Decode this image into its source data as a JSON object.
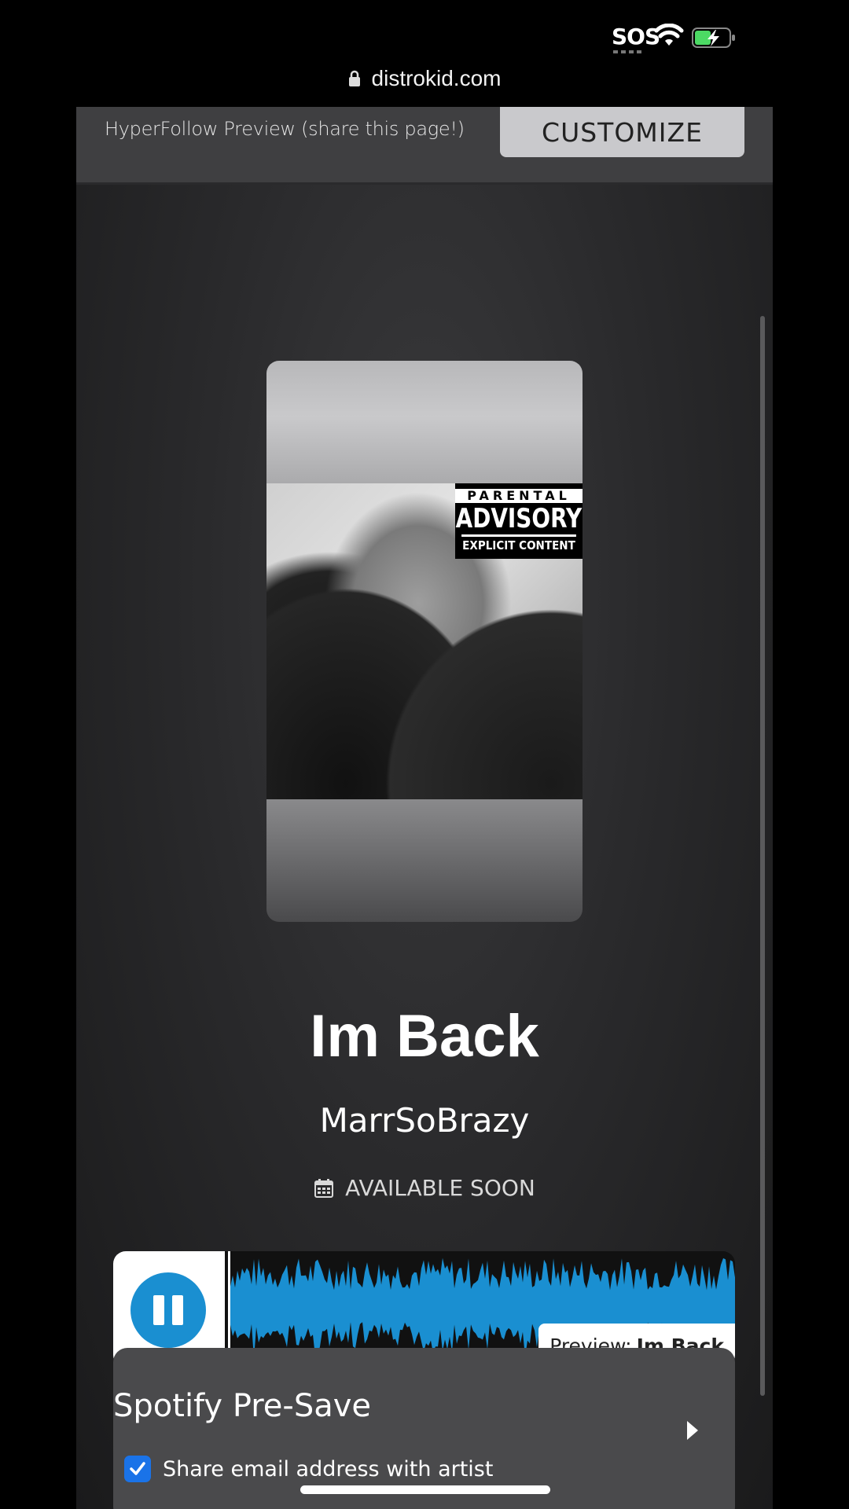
{
  "status_bar": {
    "sos": "SOS"
  },
  "browser": {
    "url": "distrokid.com"
  },
  "hyperfollow": {
    "header_label": "HyperFollow Preview (share this page!)",
    "customize_label": "CUSTOMIZE"
  },
  "artwork": {
    "advisory_line1": "PARENTAL",
    "advisory_line2": "ADVISORY",
    "advisory_line3": "EXPLICIT CONTENT"
  },
  "release": {
    "title": "Im Back",
    "artist": "MarrSoBrazy",
    "availability": "AVAILABLE SOON"
  },
  "player": {
    "state": "playing",
    "preview_prefix": "Preview:",
    "preview_title": "Im Back",
    "accent_color": "#1a8fd1"
  },
  "presave": {
    "title": "Spotify Pre-Save",
    "share_email_label": "Share email address with artist",
    "share_email_checked": true
  },
  "icons": [
    "lock-icon",
    "wifi-icon",
    "battery-charging-icon",
    "calendar-icon",
    "pause-icon",
    "chevron-right-icon",
    "checkbox-icon"
  ]
}
